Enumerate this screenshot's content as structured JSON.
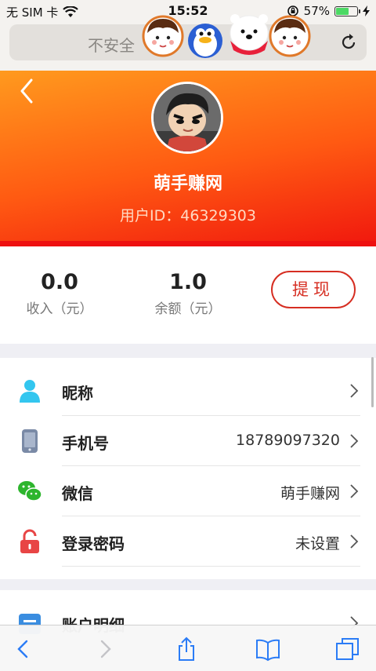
{
  "status_bar": {
    "carrier": "无 SIM 卡",
    "time": "15:52",
    "battery": "57%",
    "battery_level": 0.57
  },
  "browser": {
    "url_text": "不安全"
  },
  "profile": {
    "username": "萌手赚网",
    "user_id": "用户ID：46329303"
  },
  "balance": {
    "income_value": "0.0",
    "income_label": "收入（元）",
    "balance_value": "1.0",
    "balance_label": "余额（元）",
    "withdraw_label": "提现"
  },
  "settings": [
    {
      "label": "昵称",
      "value": "",
      "icon": "person-icon"
    },
    {
      "label": "手机号",
      "value": "18789097320",
      "icon": "phone-icon"
    },
    {
      "label": "微信",
      "value": "萌手赚网",
      "icon": "wechat-icon"
    },
    {
      "label": "登录密码",
      "value": "未设置",
      "icon": "lock-icon"
    }
  ],
  "account": {
    "label": "账户明细",
    "icon": "account-details-icon"
  },
  "colors": {
    "header_start": "#ff9a1e",
    "header_end": "#f11a0e",
    "accent_red": "#d62e22"
  }
}
